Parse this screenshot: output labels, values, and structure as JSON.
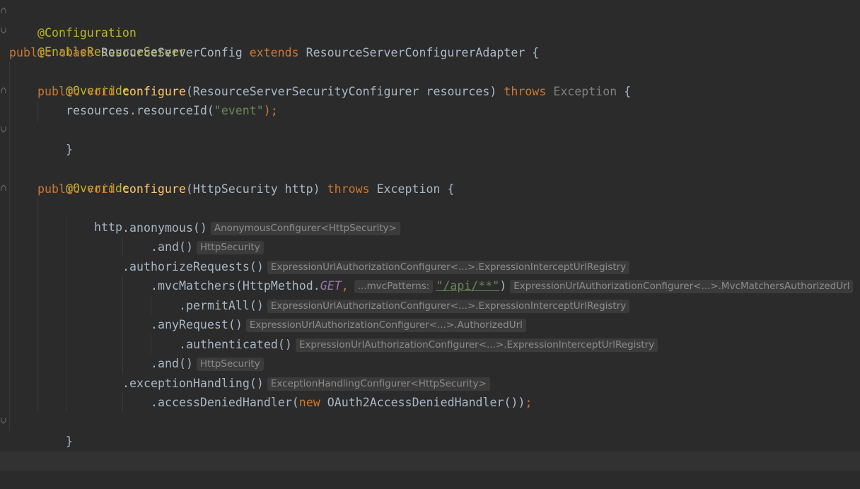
{
  "editor": {
    "code": {
      "l1": {
        "ann": "@Configuration"
      },
      "l2": {
        "ann": "@EnableResourceServer"
      },
      "l3": {
        "kw1": "public class ",
        "name": "ResourceServerConfig ",
        "kw2": "extends ",
        "parent": "ResourceServerConfigurerAdapter {"
      },
      "l4": {
        "ann": "@Override"
      },
      "l5": {
        "kw": "public void ",
        "fn": "configure",
        "params": "(ResourceServerSecurityConfigurer resources) ",
        "throws": "throws ",
        "exc": "Exception",
        "brace": " {"
      },
      "l6": {
        "call": "resources.resourceId(",
        "str": "\"event\"",
        "end": ");"
      },
      "l7": {
        "brace": "}"
      },
      "l9": {
        "ann": "@Override"
      },
      "l10": {
        "kw": "public void ",
        "fn": "configure",
        "params": "(HttpSecurity http) ",
        "throws": "throws ",
        "exc": "Exception",
        "brace": " {"
      },
      "l11": {
        "text": "http"
      },
      "l12": {
        "call": ".anonymous()",
        "hint": "AnonymousConfigurer<HttpSecurity>"
      },
      "l13": {
        "call": ".and()",
        "hint": "HttpSecurity"
      },
      "l14": {
        "call": ".authorizeRequests()",
        "hint": "ExpressionUrlAuthorizationConfigurer<...>.ExpressionInterceptUrlRegistry"
      },
      "l15": {
        "call": ".mvcMatchers(HttpMethod.",
        "const": "GET",
        "comma": ",",
        "param_hint": "...mvcPatterns:",
        "str": "\"/api/**\"",
        "close": ")",
        "hint": "ExpressionUrlAuthorizationConfigurer<...>.MvcMatchersAuthorizedUrl"
      },
      "l16": {
        "call": ".permitAll()",
        "hint": "ExpressionUrlAuthorizationConfigurer<...>.ExpressionInterceptUrlRegistry"
      },
      "l17": {
        "call": ".anyRequest()",
        "hint": "ExpressionUrlAuthorizationConfigurer<...>.AuthorizedUrl"
      },
      "l18": {
        "call": ".authenticated()",
        "hint": "ExpressionUrlAuthorizationConfigurer<...>.ExpressionInterceptUrlRegistry"
      },
      "l19": {
        "call": ".and()",
        "hint": "HttpSecurity"
      },
      "l20": {
        "call": ".exceptionHandling()",
        "hint": "ExceptionHandlingConfigurer<HttpSecurity>"
      },
      "l21": {
        "call": ".accessDeniedHandler(",
        "kw": "new ",
        "obj": "OAuth2AccessDeniedHandler())",
        "end": ";"
      },
      "l22": {
        "brace": "}"
      },
      "l23": {
        "brace": "}"
      }
    },
    "colors": {
      "background": "#2b2b2b",
      "keyword": "#cc7832",
      "annotation": "#bbb529",
      "method": "#ffc66d",
      "string": "#6a8759",
      "constant": "#9876aa",
      "text": "#a9b7c6"
    }
  }
}
